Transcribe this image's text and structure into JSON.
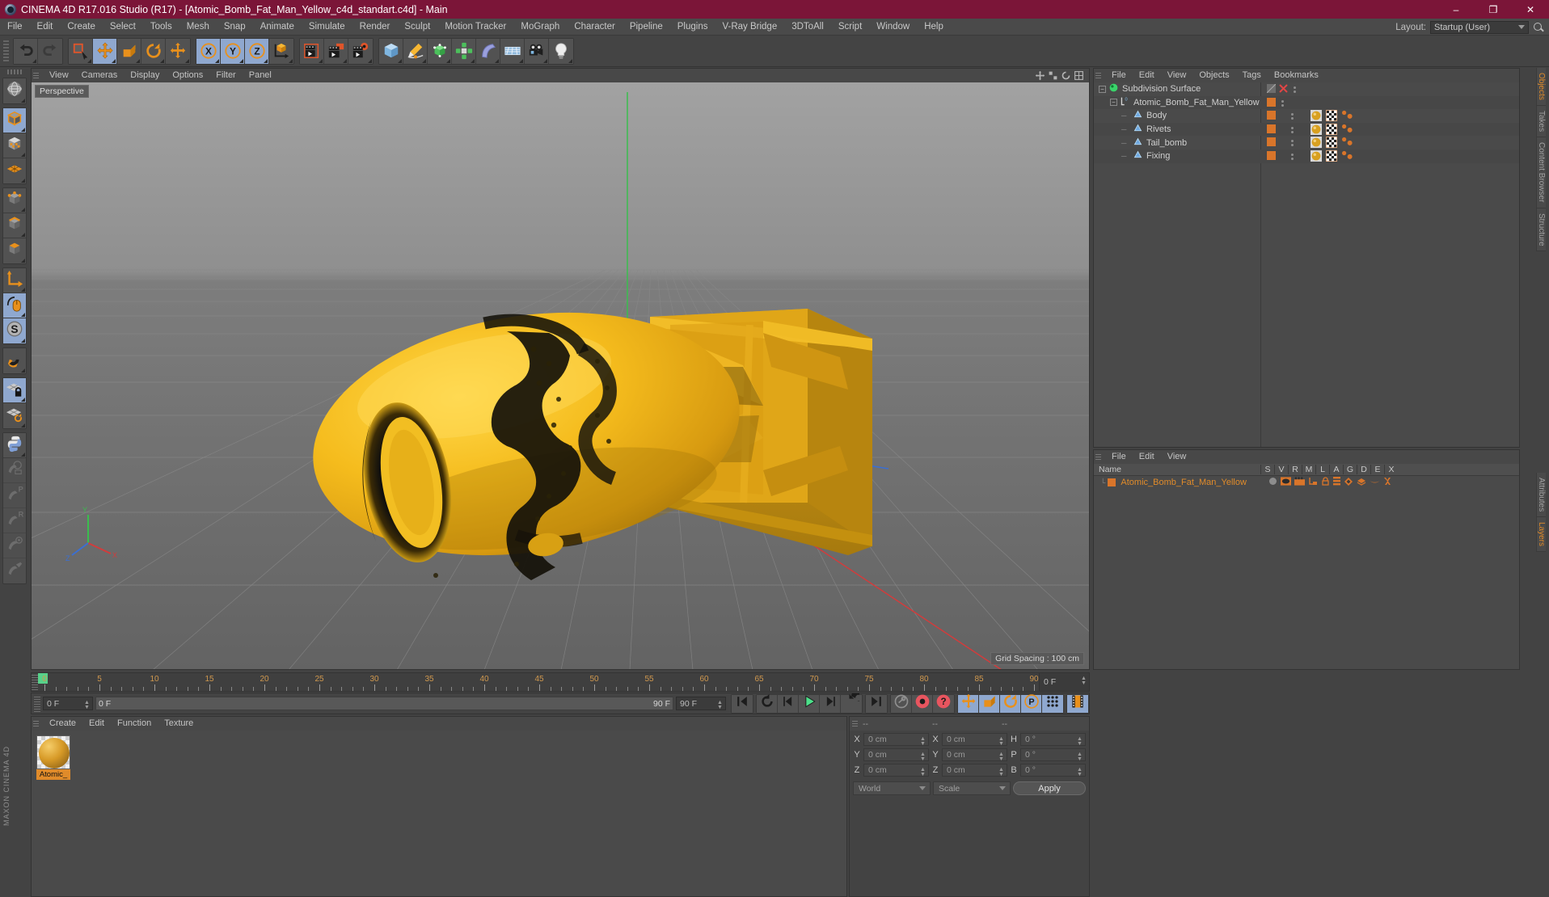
{
  "window": {
    "title": "CINEMA 4D R17.016 Studio (R17) - [Atomic_Bomb_Fat_Man_Yellow_c4d_standart.c4d] - Main",
    "logo_icon": "c4d-logo-icon",
    "minimize": "–",
    "maximize": "❐",
    "close": "✕",
    "titlebar_color": "#7b1538"
  },
  "menubar": {
    "items": [
      "File",
      "Edit",
      "Create",
      "Select",
      "Tools",
      "Mesh",
      "Snap",
      "Animate",
      "Simulate",
      "Render",
      "Sculpt",
      "Motion Tracker",
      "MoGraph",
      "Character",
      "Pipeline",
      "Plugins",
      "V-Ray Bridge",
      "3DToAll",
      "Script",
      "Window",
      "Help"
    ],
    "layout_label": "Layout:",
    "layout_value": "Startup (User)",
    "search_icon": "search-icon"
  },
  "toolbar": {
    "groups": [
      {
        "name": "undo-redo",
        "buttons": [
          {
            "name": "undo-button",
            "icon": "undo-icon",
            "selected": false,
            "disabled": false
          },
          {
            "name": "redo-button",
            "icon": "redo-icon",
            "selected": false,
            "disabled": true
          }
        ]
      },
      {
        "name": "transform-tools",
        "buttons": [
          {
            "name": "select-tool",
            "icon": "live-selection-icon",
            "selected": false,
            "disabled": false
          },
          {
            "name": "move-tool",
            "icon": "move-icon",
            "selected": true,
            "disabled": false
          },
          {
            "name": "scale-tool",
            "icon": "scale-icon",
            "selected": false,
            "disabled": false
          },
          {
            "name": "rotate-tool",
            "icon": "rotate-icon",
            "selected": false,
            "disabled": false
          },
          {
            "name": "move-free-tool",
            "icon": "move-free-icon",
            "selected": false,
            "disabled": false
          }
        ]
      },
      {
        "name": "axis-locks",
        "buttons": [
          {
            "name": "x-axis-lock",
            "icon": "x-axis-icon",
            "selected": true,
            "disabled": false
          },
          {
            "name": "y-axis-lock",
            "icon": "y-axis-icon",
            "selected": true,
            "disabled": false
          },
          {
            "name": "z-axis-lock",
            "icon": "z-axis-icon",
            "selected": true,
            "disabled": false
          },
          {
            "name": "world-object-coords",
            "icon": "world-axis-icon",
            "selected": false,
            "disabled": false
          }
        ]
      },
      {
        "name": "render-tools",
        "buttons": [
          {
            "name": "render-view-button",
            "icon": "render-view-icon",
            "selected": false,
            "disabled": false
          },
          {
            "name": "render-region-button",
            "icon": "render-region-icon",
            "selected": false,
            "disabled": false
          },
          {
            "name": "render-settings-button",
            "icon": "render-settings-icon",
            "selected": false,
            "disabled": false
          }
        ]
      },
      {
        "name": "create-objects",
        "buttons": [
          {
            "name": "add-cube-button",
            "icon": "cube-icon",
            "selected": false,
            "disabled": false
          },
          {
            "name": "add-spline-button",
            "icon": "pen-spline-icon",
            "selected": false,
            "disabled": false
          },
          {
            "name": "add-nurbs-button",
            "icon": "hypernurbs-icon",
            "selected": false,
            "disabled": false
          },
          {
            "name": "add-mograph-button",
            "icon": "mograph-cloner-icon",
            "selected": false,
            "disabled": false
          },
          {
            "name": "add-deformer-button",
            "icon": "bend-deformer-icon",
            "selected": false,
            "disabled": false
          },
          {
            "name": "add-environment-button",
            "icon": "floor-environment-icon",
            "selected": false,
            "disabled": false
          },
          {
            "name": "add-camera-button",
            "icon": "camera-icon",
            "selected": false,
            "disabled": false
          },
          {
            "name": "add-light-button",
            "icon": "light-bulb-icon",
            "selected": false,
            "disabled": false
          }
        ]
      }
    ]
  },
  "left_palette": {
    "groups": [
      [
        {
          "name": "undo-view-button",
          "icon": "globe-wire-icon",
          "selected": false,
          "disabled": false
        }
      ],
      [
        {
          "name": "model-mode-button",
          "icon": "model-cube-icon",
          "selected": true,
          "disabled": false
        },
        {
          "name": "texture-mode-button",
          "icon": "texture-cube-icon",
          "selected": false,
          "disabled": false
        },
        {
          "name": "workplane-mode-button",
          "icon": "workplane-icon",
          "selected": false,
          "disabled": false
        }
      ],
      [
        {
          "name": "points-mode-button",
          "icon": "points-cube-icon",
          "selected": false,
          "disabled": false
        },
        {
          "name": "edges-mode-button",
          "icon": "edges-cube-icon",
          "selected": false,
          "disabled": false
        },
        {
          "name": "polygons-mode-button",
          "icon": "polygons-cube-icon",
          "selected": false,
          "disabled": false
        }
      ],
      [
        {
          "name": "axis-mode-button",
          "icon": "axis-l-icon",
          "selected": false,
          "disabled": false
        },
        {
          "name": "enable-axis-button",
          "icon": "mouse-axis-icon",
          "selected": true,
          "disabled": false
        },
        {
          "name": "soft-selection-button",
          "icon": "s-circle-icon",
          "selected": true,
          "disabled": false
        }
      ],
      [
        {
          "name": "snap-toggle-button",
          "icon": "magnet-icon",
          "selected": false,
          "disabled": false
        }
      ],
      [
        {
          "name": "lock-workplane-button",
          "icon": "workplane-lock-icon",
          "selected": true,
          "disabled": false
        },
        {
          "name": "align-workplane-button",
          "icon": "workplane-rotate-icon",
          "selected": false,
          "disabled": false
        }
      ],
      [
        {
          "name": "python-button",
          "icon": "python-icon",
          "selected": false,
          "disabled": false
        },
        {
          "name": "viewport-solo-button",
          "icon": "viewport-solo-icon",
          "selected": false,
          "disabled": true
        },
        {
          "name": "parametric-button",
          "icon": "brush-p-icon",
          "selected": false,
          "disabled": true
        },
        {
          "name": "render-brush-button",
          "icon": "brush-r-icon",
          "selected": false,
          "disabled": true
        },
        {
          "name": "target-brush-button",
          "icon": "brush-target-icon",
          "selected": false,
          "disabled": true
        },
        {
          "name": "paint-brush-button",
          "icon": "brush-paint-icon",
          "selected": false,
          "disabled": true
        }
      ]
    ],
    "brand": "MAXON CINEMA 4D"
  },
  "viewport": {
    "menu": [
      "View",
      "Cameras",
      "Display",
      "Options",
      "Filter",
      "Panel"
    ],
    "label": "Perspective",
    "grid_spacing": "Grid Spacing : 100 cm",
    "panel_icons": [
      "move-camera-icon",
      "scale-camera-icon",
      "pan-camera-icon",
      "maximize-viewport-icon"
    ],
    "background_top": "#9a9a9a",
    "background_bottom": "#6e6e6e",
    "model_color": "#f0b81a"
  },
  "object_manager": {
    "menu": [
      "File",
      "Edit",
      "View",
      "Objects",
      "Tags",
      "Bookmarks"
    ],
    "rows": [
      {
        "name": "Subdivision Surface",
        "icon": "subdivision-surface-icon",
        "depth": 0,
        "expander": "minus",
        "tags": [
          "hidden-tag",
          "x-tag"
        ]
      },
      {
        "name": "Atomic_Bomb_Fat_Man_Yellow",
        "icon": "null-layer-icon",
        "depth": 1,
        "expander": "minus",
        "tags": [
          "orange-tag"
        ]
      },
      {
        "name": "Body",
        "icon": "polygon-object-icon",
        "depth": 2,
        "expander": "none",
        "tags": [
          "orange-tag",
          "material-tag",
          "uvw-tag",
          "selection-tag"
        ]
      },
      {
        "name": "Rivets",
        "icon": "polygon-object-icon",
        "depth": 2,
        "expander": "none",
        "tags": [
          "orange-tag",
          "material-tag",
          "uvw-tag",
          "selection-tag"
        ]
      },
      {
        "name": "Tail_bomb",
        "icon": "polygon-object-icon",
        "depth": 2,
        "expander": "none",
        "tags": [
          "orange-tag",
          "material-tag",
          "uvw-tag",
          "selection-tag"
        ]
      },
      {
        "name": "Fixing",
        "icon": "polygon-object-icon",
        "depth": 2,
        "expander": "none",
        "tags": [
          "orange-tag",
          "material-tag",
          "uvw-tag",
          "selection-tag"
        ]
      }
    ]
  },
  "layer_manager": {
    "menu": [
      "File",
      "Edit",
      "View"
    ],
    "columns": [
      "Name",
      "S",
      "V",
      "R",
      "M",
      "L",
      "A",
      "G",
      "D",
      "E",
      "X"
    ],
    "rows": [
      {
        "name": "Atomic_Bomb_Fat_Man_Yellow",
        "color": "#d9752a"
      }
    ]
  },
  "right_tabs": {
    "top": [
      {
        "label": "Objects",
        "active": true
      },
      {
        "label": "Takes",
        "active": false
      },
      {
        "label": "Content Browser",
        "active": false
      },
      {
        "label": "Structure",
        "active": false
      }
    ],
    "bottom": [
      {
        "label": "Attributes",
        "active": false
      },
      {
        "label": "Layers",
        "active": true
      }
    ]
  },
  "timeline": {
    "labels": [
      "0",
      "5",
      "10",
      "15",
      "20",
      "25",
      "30",
      "35",
      "40",
      "45",
      "50",
      "55",
      "60",
      "65",
      "70",
      "75",
      "80",
      "85",
      "90"
    ],
    "min": 0,
    "max": 90,
    "current_frame": "0 F",
    "playhead_frame": 0
  },
  "transport": {
    "current_frame": "0 F",
    "range_start": "0 F",
    "range_end": "90 F",
    "end_frame": "90 F",
    "buttons": [
      {
        "name": "go-to-start-button",
        "icon": "skip-start-icon",
        "selected": false
      },
      {
        "name": "play-backwards-loop-button",
        "icon": "loop-back-icon",
        "selected": false
      },
      {
        "name": "step-back-button",
        "icon": "step-back-icon",
        "selected": false
      },
      {
        "name": "play-button",
        "icon": "play-icon",
        "selected": false
      },
      {
        "name": "step-forward-button",
        "icon": "step-forward-icon",
        "selected": false
      },
      {
        "name": "loop-forward-button",
        "icon": "loop-forward-icon",
        "selected": false
      },
      {
        "name": "go-to-end-button",
        "icon": "skip-end-icon",
        "selected": false
      },
      {
        "name": "autokey-button",
        "icon": "key-circle-icon",
        "selected": false
      },
      {
        "name": "record-button",
        "icon": "record-keyframe-icon",
        "selected": false
      },
      {
        "name": "autokeying-button",
        "icon": "autokey-question-icon",
        "selected": false
      },
      {
        "name": "record-position-button",
        "icon": "position-key-icon",
        "selected": true
      },
      {
        "name": "record-scale-button",
        "icon": "scale-key-icon",
        "selected": true
      },
      {
        "name": "record-rotation-button",
        "icon": "rotation-key-icon",
        "selected": true
      },
      {
        "name": "record-param-button",
        "icon": "param-key-icon",
        "selected": true
      },
      {
        "name": "point-level-anim-button",
        "icon": "pla-dots-icon",
        "selected": true
      },
      {
        "name": "keyframe-selection-button",
        "icon": "filmstrip-icon",
        "selected": true
      }
    ]
  },
  "material_manager": {
    "menu": [
      "Create",
      "Edit",
      "Function",
      "Texture"
    ],
    "materials": [
      {
        "name": "Atomic_",
        "icon": "material-sphere-icon",
        "selected": true
      }
    ]
  },
  "coordinates": {
    "headers": [
      "--",
      "--",
      "--"
    ],
    "rows": [
      {
        "label1": "X",
        "value1": "0 cm",
        "label2": "X",
        "value2": "0 cm",
        "label3": "H",
        "value3": "0 °"
      },
      {
        "label1": "Y",
        "value1": "0 cm",
        "label2": "Y",
        "value2": "0 cm",
        "label3": "P",
        "value3": "0 °"
      },
      {
        "label1": "Z",
        "value1": "0 cm",
        "label2": "Z",
        "value2": "0 cm",
        "label3": "B",
        "value3": "0 °"
      }
    ],
    "space_select": "World",
    "mode_select": "Scale",
    "apply_label": "Apply"
  }
}
